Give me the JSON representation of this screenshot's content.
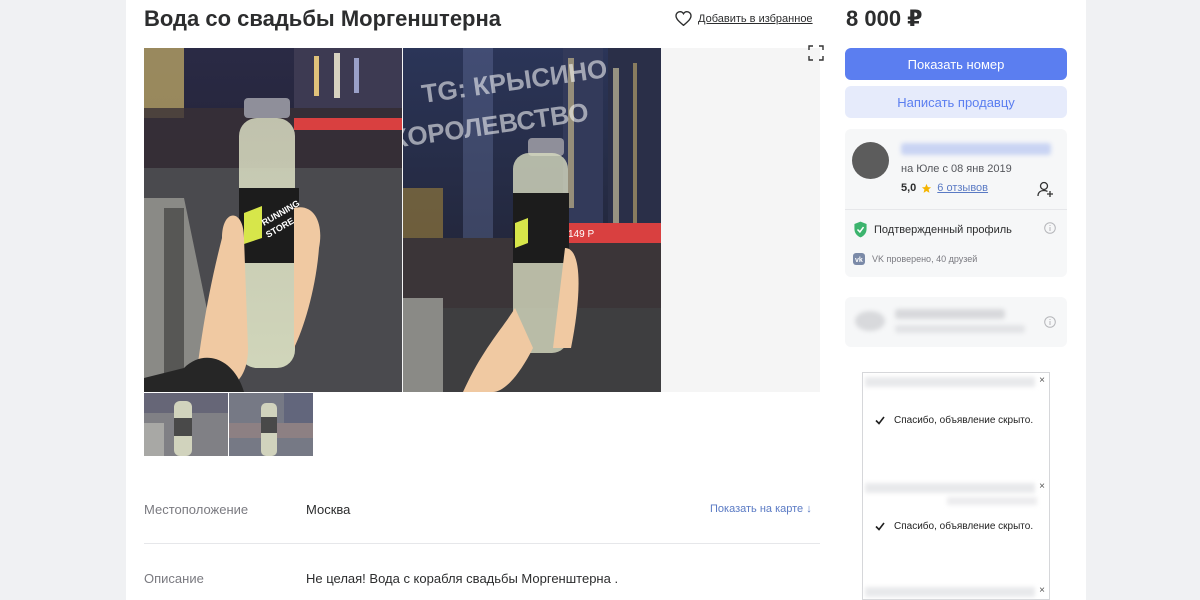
{
  "listing": {
    "title": "Вода со свадьбы Моргенштерна",
    "favorite_label": "Добавить в избранное",
    "price": "8 000 ₽"
  },
  "photo_text": {
    "watermark_line1": "TG: КРЫСИНО",
    "watermark_line2": "КОРОЛЕВСТВО",
    "bottle_brand_line1": "RUNNING",
    "bottle_brand_line2": "STORE",
    "sign_price": "149 Р"
  },
  "details": {
    "location_label": "Местоположение",
    "location_value": "Москва",
    "map_link": "Показать на карте ↓",
    "description_label": "Описание",
    "description_value": "Не целая! Вода с корабля свадьбы Моргенштерна ."
  },
  "actions": {
    "show_number": "Показать номер",
    "write_seller": "Написать продавцу"
  },
  "seller": {
    "since": "на Юле с 08 янв 2019",
    "rating": "5,0",
    "reviews": "6 отзывов",
    "verified": "Подтвержденный профиль",
    "vk": "VK проверено, 40 друзей"
  },
  "ads": {
    "hidden_message": "Спасибо, объявление скрыто.",
    "close": "×"
  },
  "colors": {
    "accent": "#5b7ef0",
    "verified_green": "#3cb46e",
    "star": "#f5b400"
  }
}
